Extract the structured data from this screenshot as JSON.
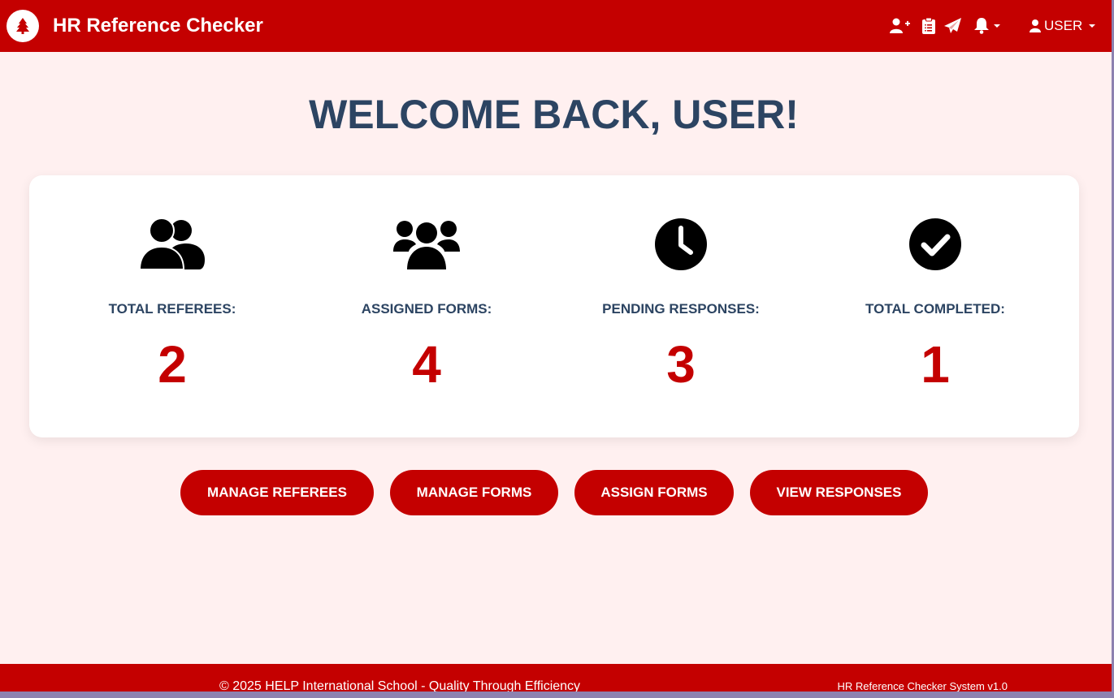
{
  "navbar": {
    "title": "HR Reference Checker",
    "logo_icon": "tree-icon",
    "icons": [
      "add-user-icon",
      "clipboard-icon",
      "paper-plane-icon",
      "bell-icon"
    ],
    "user_label": "USER"
  },
  "main": {
    "welcome": "WELCOME BACK, USER!"
  },
  "stats": [
    {
      "icon": "user-friends-icon",
      "label": "TOTAL REFEREES:",
      "value": "2"
    },
    {
      "icon": "users-icon",
      "label": "ASSIGNED FORMS:",
      "value": "4"
    },
    {
      "icon": "clock-icon",
      "label": "PENDING RESPONSES:",
      "value": "3"
    },
    {
      "icon": "check-circle-icon",
      "label": "TOTAL COMPLETED:",
      "value": "1"
    }
  ],
  "actions": [
    {
      "label": "MANAGE REFEREES"
    },
    {
      "label": "MANAGE FORMS"
    },
    {
      "label": "ASSIGN FORMS"
    },
    {
      "label": "VIEW RESPONSES"
    }
  ],
  "footer": {
    "copyright": "© 2025 HELP International School - Quality Through Efficiency",
    "version": "HR Reference Checker System v1.0"
  },
  "colors": {
    "brand": "#c40000",
    "background": "#fff0f0",
    "heading": "#2c4462"
  }
}
